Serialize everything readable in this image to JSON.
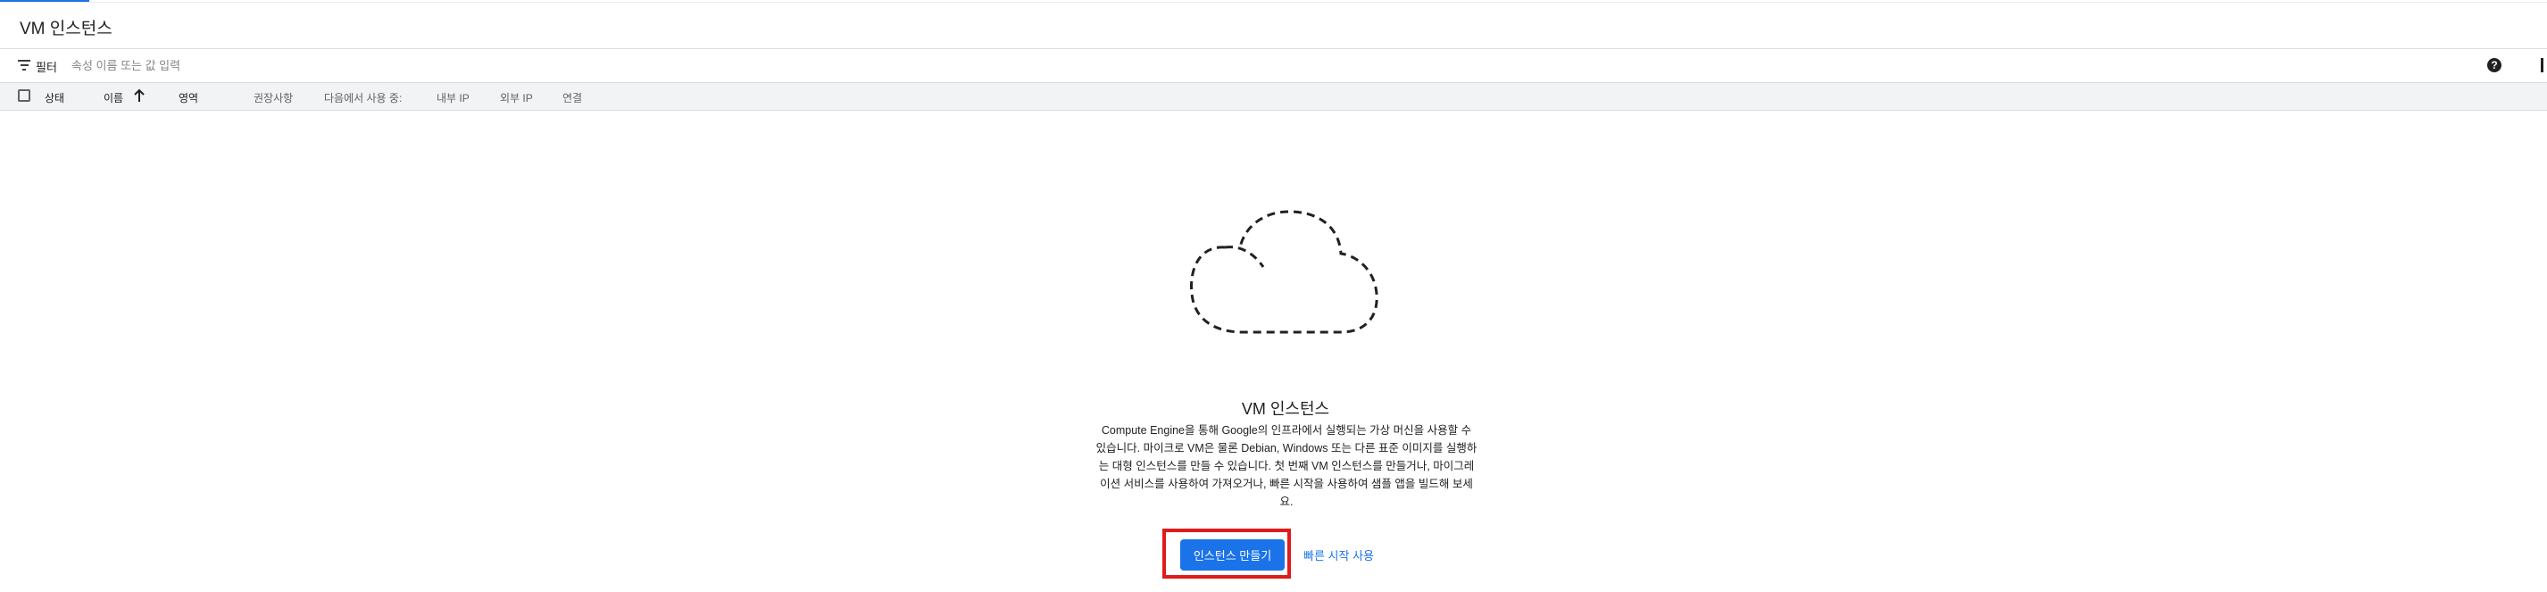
{
  "header": {
    "title": "VM 인스턴스"
  },
  "filter": {
    "label": "필터",
    "placeholder": "속성 이름 또는 값 입력"
  },
  "icons": {
    "help": "help-icon",
    "filter": "filter-icon",
    "columns": "column-display-icon",
    "sort": "arrow-up-icon",
    "empty": "cloud-outline-icon"
  },
  "table": {
    "columns": [
      "상태",
      "이름",
      "영역",
      "권장사항",
      "다음에서 사용 중:",
      "내부 IP",
      "외부 IP",
      "연결"
    ]
  },
  "empty_state": {
    "title": "VM 인스턴스",
    "description": [
      "Compute Engine을 통해 Google의 인프라에서 실행되는 가상 머신을 사용할 수",
      "있습니다. 마이크로 VM은 물론 Debian, Windows 또는 다른 표준 이미지를 실행하",
      "는 대형 인스턴스를 만들 수 있습니다. 첫 번째 VM 인스턴스를 만들거나, 마이그레",
      "이션 서비스를 사용하여 가져오거나, 빠른 시작을 사용하여 샘플 앱을 빌드해 보세",
      "요."
    ],
    "primary_button": "인스턴스 만들기",
    "secondary_link": "빠른 시작 사용"
  },
  "colors": {
    "accent": "#1a73e8",
    "highlight": "#e01b1b",
    "header_bg": "#f1f3f4"
  }
}
